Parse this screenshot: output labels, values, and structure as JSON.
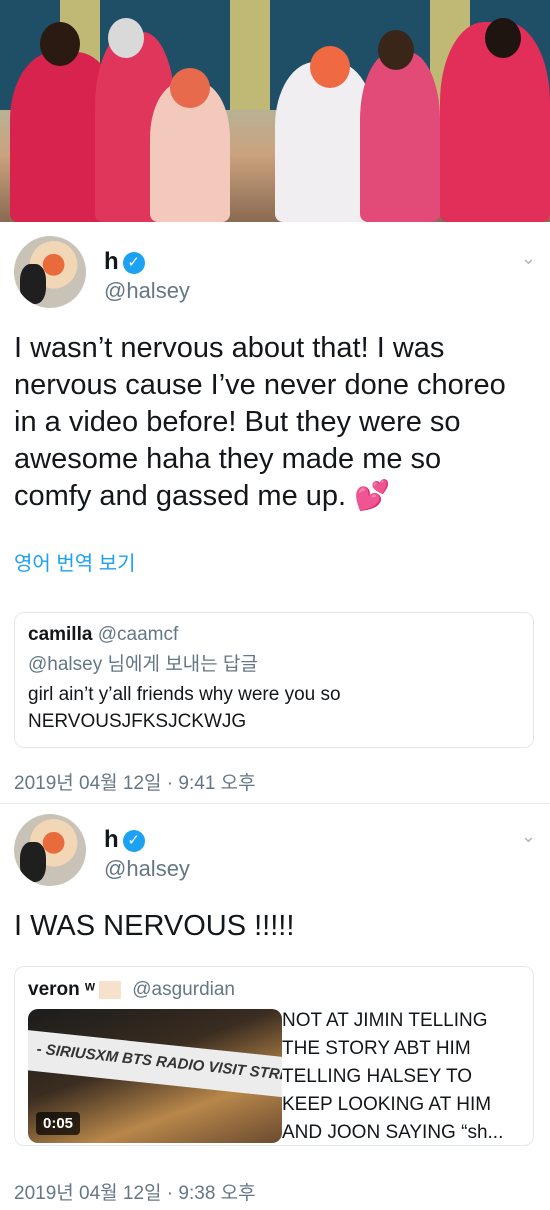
{
  "tweet1": {
    "name": "h",
    "handle": "@halsey",
    "text_lines": [
      "I wasn’t nervous about that! I was",
      "nervous cause I’ve never done choreo",
      "in a video before! But they were so",
      "awesome haha they made me so",
      "comfy and gassed me up. 💕"
    ],
    "translate": "영어 번역 보기",
    "quote": {
      "name": "camilla",
      "handle": "@caamcf",
      "reply_to": "@halsey 님에게 보내는 답글",
      "text_lines": [
        "girl ain’t y’all friends why were you so",
        "NERVOUSJFKSJCKWJG"
      ]
    },
    "timestamp": "2019년 04월 12일 · 9:41 오후"
  },
  "tweet2": {
    "name": "h",
    "handle": "@halsey",
    "text": "I WAS NERVOUS !!!!!",
    "quote": {
      "name": "veron ʷ",
      "handle": "@asgurdian",
      "media_banner": "- SIRIUSXM BTS RADIO VISIT STREAM",
      "media_duration": "0:05",
      "text_lines": [
        "NOT AT JIMIN TELLING",
        "THE STORY ABT HIM",
        "TELLING HALSEY TO",
        "KEEP LOOKING AT HIM",
        "AND JOON SAYING “sh..."
      ]
    },
    "timestamp": "2019년 04월 12일 · 9:38 오후"
  },
  "icons": {
    "verified": "verified-badge-icon",
    "menu": "chevron-down-icon"
  },
  "colors": {
    "link": "#1da1f2",
    "secondary": "#657786",
    "border": "#e1e8ed"
  }
}
